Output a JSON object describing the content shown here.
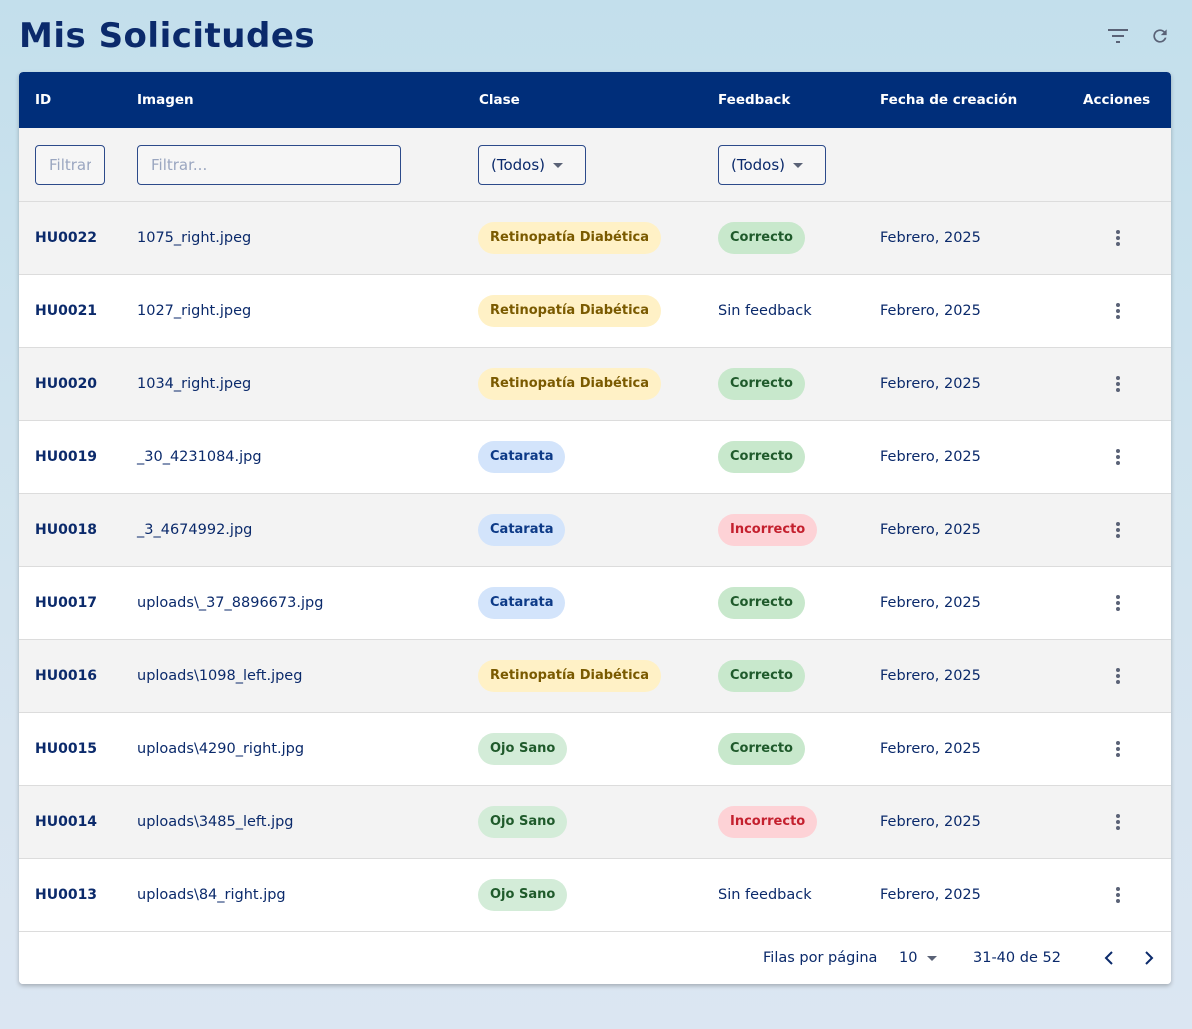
{
  "page": {
    "title": "Mis Solicitudes",
    "actions": [
      {
        "icon": "filter-icon"
      },
      {
        "icon": "refresh-icon"
      }
    ]
  },
  "colors": {
    "header_bg": "#002e7a",
    "title": "#0b2a6b",
    "chip_retino_bg": "#fff1c6",
    "chip_catarata_bg": "#d3e4fb",
    "chip_sano_bg": "#d3ecd8",
    "chip_correcto_bg": "#c8e8cc",
    "chip_incorrecto_bg": "#fdd2d6"
  },
  "table": {
    "columns": {
      "id": "ID",
      "imagen": "Imagen",
      "clase": "Clase",
      "feedback": "Feedback",
      "fecha": "Fecha de creación",
      "acciones": "Acciones"
    },
    "filters": {
      "id_placeholder": "Filtrar...",
      "imagen_placeholder": "Filtrar...",
      "clase_value": "(Todos)",
      "feedback_value": "(Todos)"
    },
    "rows": [
      {
        "id": "HU0022",
        "imagen": "1075_right.jpeg",
        "clase": "Retinopatía Diabética",
        "clase_type": "retino",
        "feedback": "Correcto",
        "feedback_type": "correcto",
        "fecha": "Febrero, 2025"
      },
      {
        "id": "HU0021",
        "imagen": "1027_right.jpeg",
        "clase": "Retinopatía Diabética",
        "clase_type": "retino",
        "feedback": "Sin feedback",
        "feedback_type": "none",
        "fecha": "Febrero, 2025"
      },
      {
        "id": "HU0020",
        "imagen": "1034_right.jpeg",
        "clase": "Retinopatía Diabética",
        "clase_type": "retino",
        "feedback": "Correcto",
        "feedback_type": "correcto",
        "fecha": "Febrero, 2025"
      },
      {
        "id": "HU0019",
        "imagen": "_30_4231084.jpg",
        "clase": "Catarata",
        "clase_type": "catarata",
        "feedback": "Correcto",
        "feedback_type": "correcto",
        "fecha": "Febrero, 2025"
      },
      {
        "id": "HU0018",
        "imagen": "_3_4674992.jpg",
        "clase": "Catarata",
        "clase_type": "catarata",
        "feedback": "Incorrecto",
        "feedback_type": "incorrecto",
        "fecha": "Febrero, 2025"
      },
      {
        "id": "HU0017",
        "imagen": "uploads\\_37_8896673.jpg",
        "clase": "Catarata",
        "clase_type": "catarata",
        "feedback": "Correcto",
        "feedback_type": "correcto",
        "fecha": "Febrero, 2025"
      },
      {
        "id": "HU0016",
        "imagen": "uploads\\1098_left.jpeg",
        "clase": "Retinopatía Diabética",
        "clase_type": "retino",
        "feedback": "Correcto",
        "feedback_type": "correcto",
        "fecha": "Febrero, 2025"
      },
      {
        "id": "HU0015",
        "imagen": "uploads\\4290_right.jpg",
        "clase": "Ojo Sano",
        "clase_type": "sano",
        "feedback": "Correcto",
        "feedback_type": "correcto",
        "fecha": "Febrero, 2025"
      },
      {
        "id": "HU0014",
        "imagen": "uploads\\3485_left.jpg",
        "clase": "Ojo Sano",
        "clase_type": "sano",
        "feedback": "Incorrecto",
        "feedback_type": "incorrecto",
        "fecha": "Febrero, 2025"
      },
      {
        "id": "HU0013",
        "imagen": "uploads\\84_right.jpg",
        "clase": "Ojo Sano",
        "clase_type": "sano",
        "feedback": "Sin feedback",
        "feedback_type": "none",
        "fecha": "Febrero, 2025"
      }
    ]
  },
  "pagination": {
    "rows_per_page_label": "Filas por página",
    "rows_per_page_value": "10",
    "range_label": "31-40 de 52",
    "prev_icon": "chevron-left-icon",
    "next_icon": "chevron-right-icon"
  }
}
